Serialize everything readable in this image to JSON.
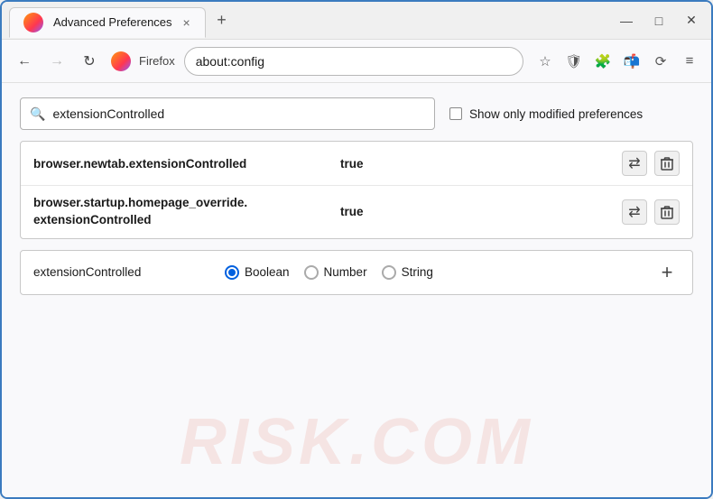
{
  "browser": {
    "title": "Advanced Preferences",
    "tab_close": "×",
    "tab_new": "+",
    "window_controls": {
      "minimize": "—",
      "maximize": "□",
      "close": "✕"
    },
    "nav": {
      "back": "←",
      "forward": "→",
      "refresh": "↻",
      "firefox_label": "Firefox",
      "address": "about:config",
      "bookmark_icon": "☆",
      "shield_icon": "🛡",
      "extension_icon": "🧩",
      "sync_icon": "📬",
      "history_icon": "⟳",
      "menu_icon": "≡"
    }
  },
  "page": {
    "search": {
      "placeholder": "extensionControlled",
      "value": "extensionControlled"
    },
    "show_modified": {
      "label": "Show only modified preferences",
      "checked": false
    },
    "results": [
      {
        "name": "browser.newtab.extensionControlled",
        "value": "true"
      },
      {
        "name": "browser.startup.homepage_override.\nextensionControlled",
        "name_line1": "browser.startup.homepage_override.",
        "name_line2": "extensionControlled",
        "value": "true",
        "multiline": true
      }
    ],
    "new_pref": {
      "name": "extensionControlled",
      "type_options": [
        {
          "label": "Boolean",
          "selected": true
        },
        {
          "label": "Number",
          "selected": false
        },
        {
          "label": "String",
          "selected": false
        }
      ],
      "add_button": "+"
    },
    "watermark": "RISK.COM",
    "action_reset": "⇄",
    "action_delete": "🗑"
  }
}
